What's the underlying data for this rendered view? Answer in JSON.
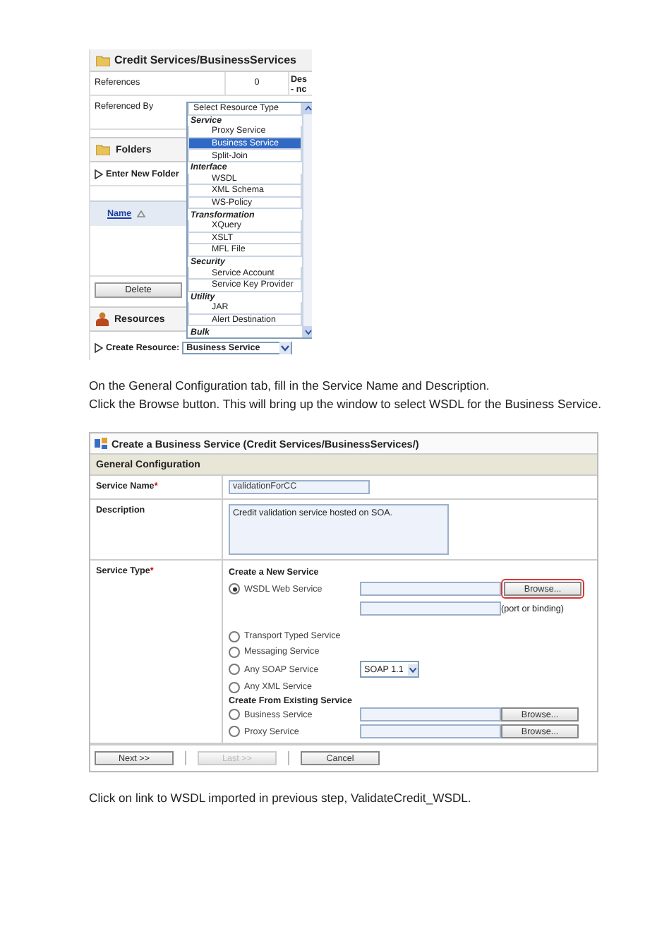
{
  "panel": {
    "title": "Credit Services/BusinessServices",
    "references": {
      "label": "References",
      "value": "0",
      "side": [
        "Des",
        "- nc"
      ]
    },
    "referenced_by": {
      "label": "Referenced By"
    },
    "folders": {
      "title": "Folders",
      "enter_new_folder": "Enter New Folder",
      "column": "Name",
      "delete_button": "Delete"
    },
    "resources": {
      "title": "Resources",
      "create_label": "Create Resource:",
      "select_value": "Business Service"
    }
  },
  "dropdown": {
    "items": [
      {
        "kind": "option",
        "label": "Select Resource Type",
        "selected": false
      },
      {
        "kind": "group",
        "label": "Service"
      },
      {
        "kind": "option",
        "label": "Proxy Service",
        "selected": false
      },
      {
        "kind": "option",
        "label": "Business Service",
        "selected": true
      },
      {
        "kind": "option",
        "label": "Split-Join",
        "selected": false
      },
      {
        "kind": "group",
        "label": "Interface"
      },
      {
        "kind": "option",
        "label": "WSDL",
        "selected": false
      },
      {
        "kind": "option",
        "label": "XML Schema",
        "selected": false
      },
      {
        "kind": "option",
        "label": "WS-Policy",
        "selected": false
      },
      {
        "kind": "group",
        "label": "Transformation"
      },
      {
        "kind": "option",
        "label": "XQuery",
        "selected": false
      },
      {
        "kind": "option",
        "label": "XSLT",
        "selected": false
      },
      {
        "kind": "option",
        "label": "MFL File",
        "selected": false
      },
      {
        "kind": "group",
        "label": "Security"
      },
      {
        "kind": "option",
        "label": "Service Account",
        "selected": false
      },
      {
        "kind": "option",
        "label": "Service Key Provider",
        "selected": false
      },
      {
        "kind": "group",
        "label": "Utility"
      },
      {
        "kind": "option",
        "label": "JAR",
        "selected": false
      },
      {
        "kind": "option",
        "label": "Alert Destination",
        "selected": false
      },
      {
        "kind": "group",
        "label": "Bulk"
      }
    ]
  },
  "instructions": [
    "On the General Configuration tab, fill in the Service Name and Description.",
    "Click the Browse button. This will bring up the window to select WSDL for the Business Service."
  ],
  "dialog": {
    "title": "Create a Business Service (Credit Services/BusinessServices/)",
    "section": "General Configuration",
    "service_name": {
      "label": "Service Name",
      "required_mark": "*",
      "value": "validationForCC"
    },
    "description": {
      "label": "Description",
      "value": "Credit validation service hosted on SOA."
    },
    "service_type": {
      "label": "Service Type",
      "required_mark": "*",
      "groups": [
        {
          "title": "Create a New Service",
          "options": [
            {
              "kind": "wsdl",
              "label": "WSDL Web Service",
              "selected": true,
              "browse_button": "Browse...",
              "highlighted": true,
              "binding_hint": "(port or binding)"
            },
            {
              "kind": "plain",
              "label": "Transport Typed Service",
              "selected": false
            },
            {
              "kind": "plain",
              "label": "Messaging Service",
              "selected": false
            },
            {
              "kind": "soap",
              "label": "Any SOAP Service",
              "selected": false,
              "select_value": "SOAP 1.1"
            },
            {
              "kind": "plain",
              "label": "Any XML Service",
              "selected": false
            }
          ]
        },
        {
          "title": "Create From Existing Service",
          "options": [
            {
              "kind": "browse",
              "label": "Business Service",
              "selected": false,
              "browse_button": "Browse..."
            },
            {
              "kind": "browse",
              "label": "Proxy Service",
              "selected": false,
              "browse_button": "Browse..."
            }
          ]
        }
      ]
    },
    "buttons": [
      {
        "label": "Next >>",
        "disabled": false
      },
      {
        "label": "Last >>",
        "disabled": true
      },
      {
        "label": "Cancel",
        "disabled": false
      }
    ]
  },
  "footer_text": "Click on link to WSDL imported in previous step, ValidateCredit_WSDL."
}
